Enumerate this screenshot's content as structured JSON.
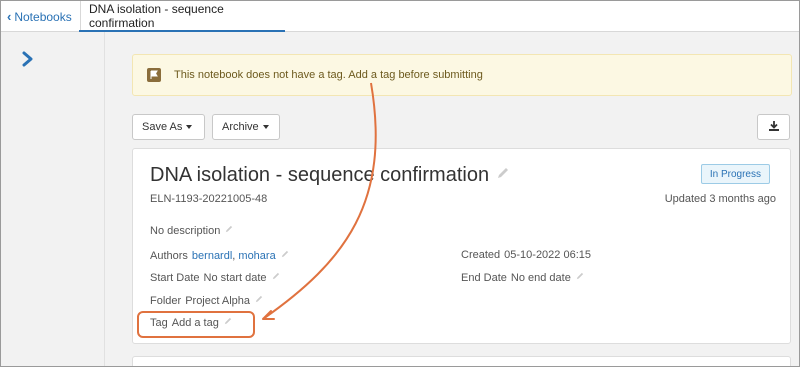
{
  "tabs": {
    "back_label": "Notebooks",
    "active_label": "DNA isolation - sequence confirmation"
  },
  "alert": {
    "message": "This notebook does not have a tag. Add a tag before submitting"
  },
  "toolbar": {
    "save_as_label": "Save As",
    "archive_label": "Archive"
  },
  "notebook": {
    "title": "DNA isolation - sequence confirmation",
    "status": "In Progress",
    "id": "ELN-1193-20221005-48",
    "updated": "Updated 3 months ago",
    "description": "No description",
    "authors_label": "Authors",
    "authors": [
      "bernardl",
      "mohara"
    ],
    "authors_separator": ", ",
    "start_label": "Start Date",
    "start_value": "No start date",
    "folder_label": "Folder",
    "folder_value": "Project Alpha",
    "tag_label": "Tag",
    "tag_value": "Add a tag",
    "created_label": "Created",
    "created_value": "05-10-2022 06:15",
    "end_label": "End Date",
    "end_value": "No end date"
  },
  "colors": {
    "accent": "#2a72b5",
    "annotation": "#e0723f",
    "alert_bg": "#fcf8e3"
  },
  "icons": {
    "expand": "chevron-right-icon",
    "flag": "flag-icon",
    "download": "download-icon",
    "edit": "pencil-icon"
  }
}
